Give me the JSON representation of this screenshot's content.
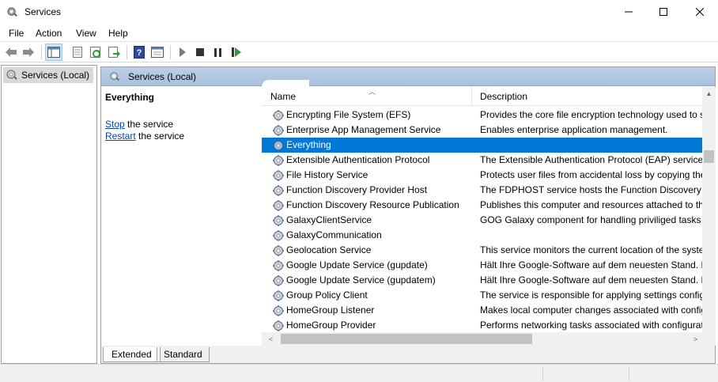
{
  "window": {
    "title": "Services"
  },
  "menu": [
    "File",
    "Action",
    "View",
    "Help"
  ],
  "toolbar": {
    "icons": [
      "back-arrow-icon",
      "forward-arrow-icon",
      "show-hide-console-tree-icon",
      "properties-icon",
      "refresh-icon",
      "export-list-icon",
      "help-icon",
      "view-icon",
      "start-service-icon",
      "stop-service-icon",
      "pause-service-icon",
      "restart-service-icon"
    ]
  },
  "tree": {
    "root_label": "Services (Local)"
  },
  "main": {
    "header_title": "Services (Local)",
    "selected_service": "Everything",
    "stop_link": "Stop",
    "stop_suffix": " the service",
    "restart_link": "Restart",
    "restart_suffix": " the service"
  },
  "columns": {
    "name": "Name",
    "description": "Description"
  },
  "rows": [
    {
      "name": "Encrypting File System (EFS)",
      "desc": "Provides the core file encryption technology used to s"
    },
    {
      "name": "Enterprise App Management Service",
      "desc": "Enables enterprise application management."
    },
    {
      "name": "Everything",
      "desc": ""
    },
    {
      "name": "Extensible Authentication Protocol",
      "desc": "The Extensible Authentication Protocol (EAP) service p"
    },
    {
      "name": "File History Service",
      "desc": "Protects user files from accidental loss by copying the"
    },
    {
      "name": "Function Discovery Provider Host",
      "desc": "The FDPHOST service hosts the Function Discovery (F"
    },
    {
      "name": "Function Discovery Resource Publication",
      "desc": "Publishes this computer and resources attached to thi"
    },
    {
      "name": "GalaxyClientService",
      "desc": "GOG Galaxy component for handling priviliged tasks"
    },
    {
      "name": "GalaxyCommunication",
      "desc": ""
    },
    {
      "name": "Geolocation Service",
      "desc": "This service monitors the current location of the syste"
    },
    {
      "name": "Google Update Service (gupdate)",
      "desc": "Hält Ihre Google-Software auf dem neuesten Stand. Fa"
    },
    {
      "name": "Google Update Service (gupdatem)",
      "desc": "Hält Ihre Google-Software auf dem neuesten Stand. Fa"
    },
    {
      "name": "Group Policy Client",
      "desc": "The service is responsible for applying settings config"
    },
    {
      "name": "HomeGroup Listener",
      "desc": "Makes local computer changes associated with config"
    },
    {
      "name": "HomeGroup Provider",
      "desc": "Performs networking tasks associated with configurat"
    }
  ],
  "selected_index": 2,
  "tabs": {
    "extended": "Extended",
    "standard": "Standard"
  },
  "colors": {
    "selection": "#0078d7",
    "header_gradient": "#bcd0e7",
    "link": "#0645ad"
  }
}
